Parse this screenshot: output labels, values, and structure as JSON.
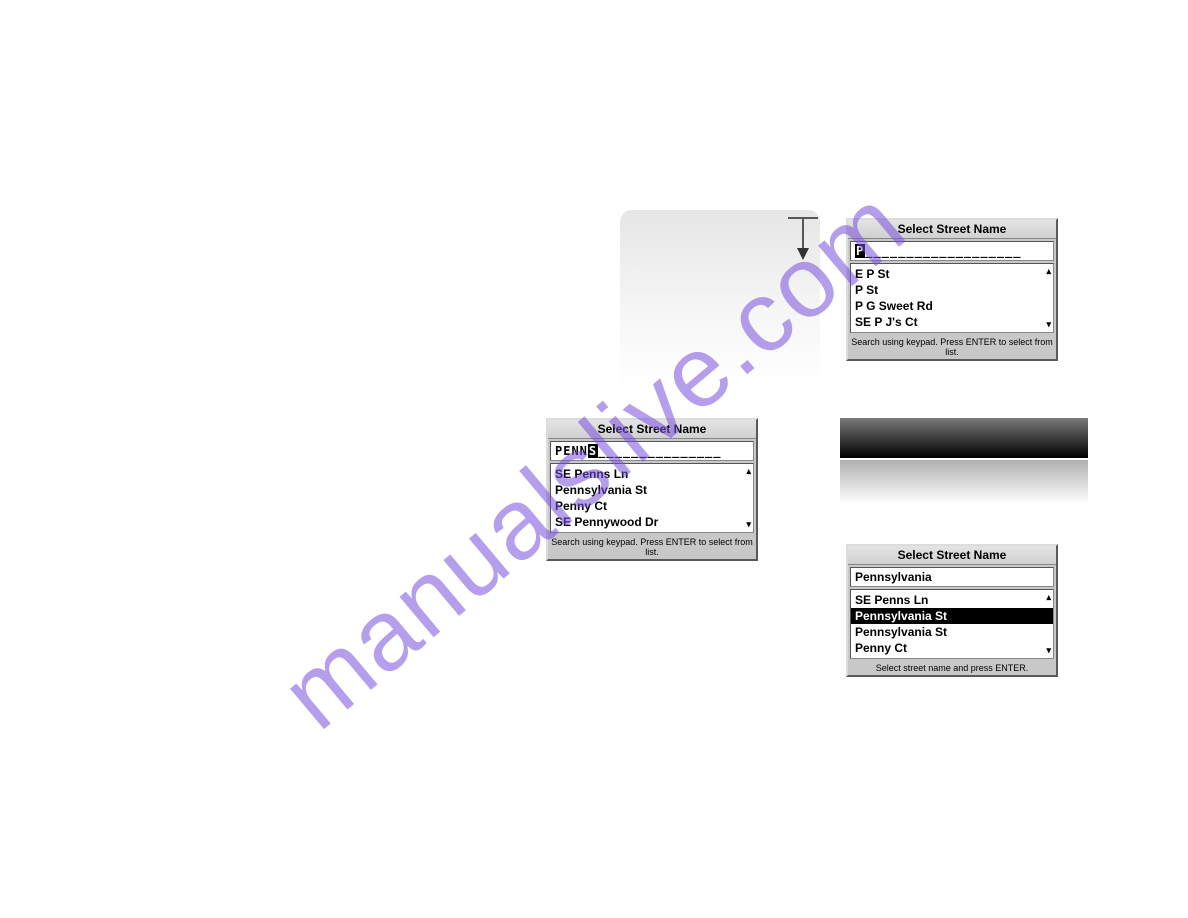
{
  "watermark": "manualslive.com",
  "panel1": {
    "title": "Select Street Name",
    "field_prefix": "",
    "field_hl": "P",
    "field_rest": "___________________",
    "items": [
      "E P St",
      "P St",
      "P G Sweet Rd",
      "SE P J's Ct"
    ],
    "hint": "Search using keypad.  Press ENTER to select from list."
  },
  "panel2": {
    "title": "Select Street Name",
    "field_prefix": "PENN",
    "field_hl": "S",
    "field_rest": "_______________",
    "items": [
      "SE Penns Ln",
      "Pennsylvania St",
      "Penny Ct",
      "SE Pennywood Dr"
    ],
    "hint": "Search using keypad.  Press ENTER to select from list."
  },
  "panel3": {
    "title": "Select Street Name",
    "field_prefix": "Pennsylvania",
    "items": [
      "SE Penns Ln",
      "Pennsylvania St",
      "Pennsylvania St",
      "Penny Ct"
    ],
    "selected_index": 1,
    "hint": "Select street name and press ENTER."
  }
}
